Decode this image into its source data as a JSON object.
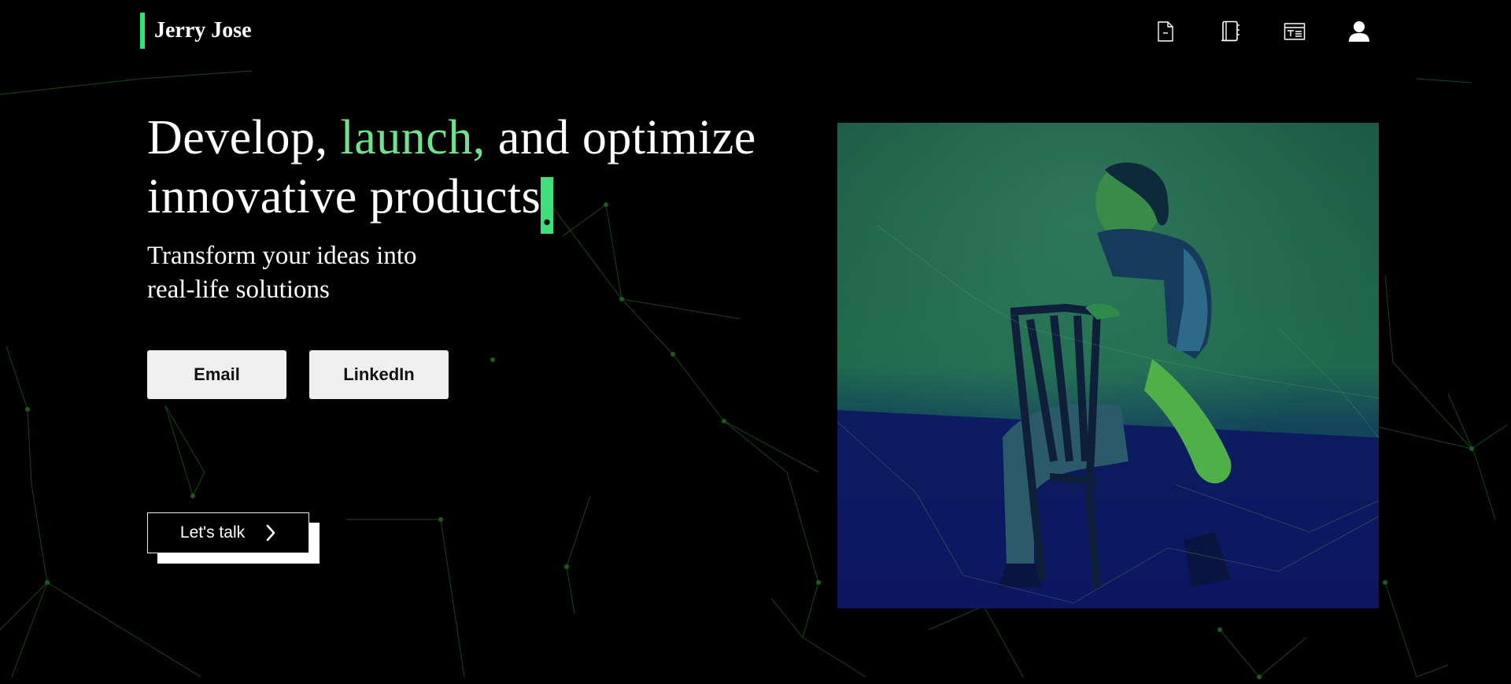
{
  "brand": {
    "name": "Jerry Jose"
  },
  "nav": {
    "items": [
      {
        "icon": "document-icon",
        "name": "Resume"
      },
      {
        "icon": "notebook-icon",
        "name": "Blog"
      },
      {
        "icon": "projects-icon",
        "name": "Projects"
      },
      {
        "icon": "user-icon",
        "name": "About"
      }
    ]
  },
  "hero": {
    "headline": {
      "part1": "Develop, ",
      "accent": "launch,",
      "part2": " and optimize",
      "line2": "innovative products",
      "dot": "."
    },
    "subhead": {
      "line1": "Transform your ideas into",
      "line2": "real-life solutions"
    },
    "buttons": {
      "email": "Email",
      "linkedin": "LinkedIn"
    },
    "cta": {
      "label": "Let's talk",
      "icon": "chevron-right-icon"
    }
  },
  "colors": {
    "background": "#000000",
    "accent": "#6fe38b",
    "brand_bar": "#2ee57a",
    "photo_top": "#1f6b4a",
    "photo_bottom": "#0a1a5c"
  }
}
